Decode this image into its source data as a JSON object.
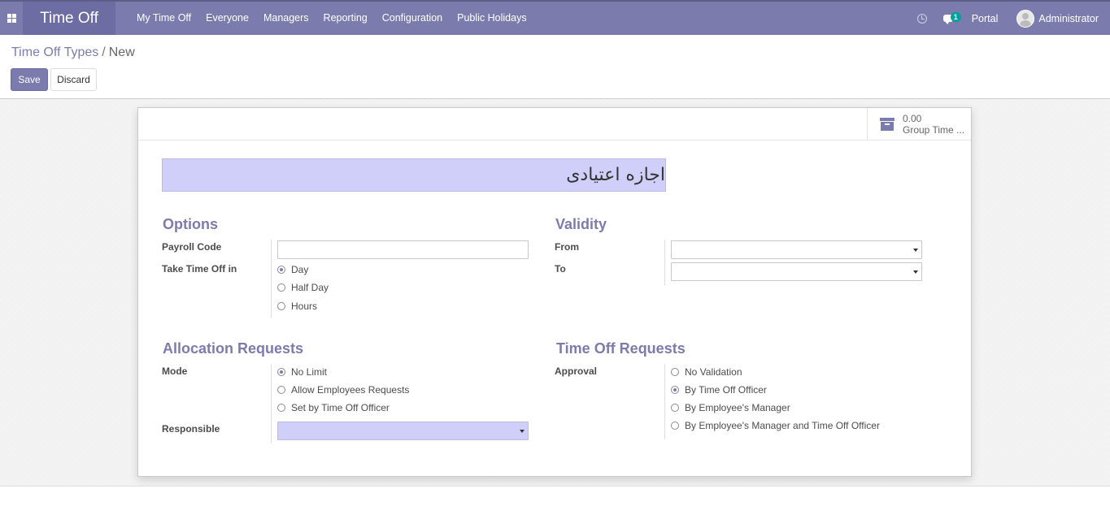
{
  "navbar": {
    "app_title": "Time Off",
    "menu": [
      "My Time Off",
      "Everyone",
      "Managers",
      "Reporting",
      "Configuration",
      "Public Holidays"
    ],
    "notification_count": "1",
    "portal_label": "Portal",
    "user_name": "Administrator"
  },
  "control_panel": {
    "breadcrumb_parent": "Time Off Types",
    "breadcrumb_separator": "/",
    "breadcrumb_current": "New",
    "save_label": "Save",
    "discard_label": "Discard"
  },
  "form": {
    "stat_button": {
      "value": "0.00",
      "label": "Group Time ..."
    },
    "name_value": "اجازه اعتیادی",
    "options": {
      "title": "Options",
      "payroll_code_label": "Payroll Code",
      "payroll_code_value": "",
      "take_time_off_label": "Take Time Off in",
      "take_time_off_options": [
        "Day",
        "Half Day",
        "Hours"
      ],
      "take_time_off_selected": "Day"
    },
    "validity": {
      "title": "Validity",
      "from_label": "From",
      "from_value": "",
      "to_label": "To",
      "to_value": ""
    },
    "allocation": {
      "title": "Allocation Requests",
      "mode_label": "Mode",
      "mode_options": [
        "No Limit",
        "Allow Employees Requests",
        "Set by Time Off Officer"
      ],
      "mode_selected": "No Limit",
      "responsible_label": "Responsible",
      "responsible_value": ""
    },
    "time_off_requests": {
      "title": "Time Off Requests",
      "approval_label": "Approval",
      "approval_options": [
        "No Validation",
        "By Time Off Officer",
        "By Employee's Manager",
        "By Employee's Manager and Time Off Officer"
      ],
      "approval_selected": "By Time Off Officer"
    }
  },
  "colors": {
    "brand": "#7c7bad",
    "required_field": "#cfcffa"
  }
}
